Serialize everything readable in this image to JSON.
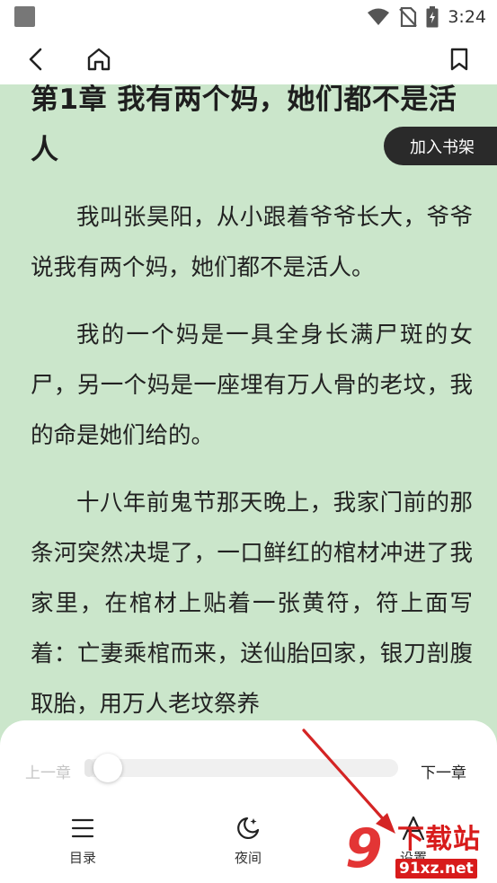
{
  "status_bar": {
    "time": "3:24",
    "icons": [
      "wifi-icon",
      "no-sim-icon",
      "battery-charging-icon"
    ]
  },
  "nav": {
    "icons": [
      "back-icon",
      "home-icon",
      "bookmark-icon"
    ]
  },
  "reader": {
    "chapter_title": "第1章 我有两个妈，她们都不是活人",
    "paragraphs": [
      "我叫张昊阳，从小跟着爷爷长大，爷爷说我有两个妈，她们都不是活人。",
      "我的一个妈是一具全身长满尸斑的女尸，另一个妈是一座埋有万人骨的老坟，我的命是她们给的。",
      "十八年前鬼节那天晚上，我家门前的那条河突然决堤了，一口鲜红的棺材冲进了我家里，在棺材上贴着一张黄符，符上面写着：亡妻乘棺而来，送仙胎回家，银刀剖腹取胎，用万人老坟祭养"
    ],
    "background_color": "#cbe6cb"
  },
  "add_to_shelf": "加入书架",
  "bottom_panel": {
    "prev_chapter": "上一章",
    "next_chapter": "下一章",
    "progress": 0.03,
    "tools": [
      {
        "label": "目录",
        "icon": "menu-icon"
      },
      {
        "label": "夜间",
        "icon": "moon-icon"
      },
      {
        "label": "设置",
        "icon": "font-settings-icon"
      }
    ]
  },
  "watermark": {
    "logo_digit": "9",
    "title": "下载站",
    "domain": "91xz.net"
  },
  "annotation_color": "#d42424"
}
